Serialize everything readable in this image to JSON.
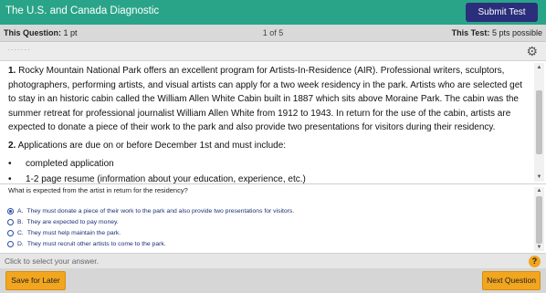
{
  "header": {
    "title": "The U.S. and Canada Diagnostic",
    "submit_label": "Submit Test",
    "accent": "#2aa488",
    "submit_color": "#2b2e7a"
  },
  "infobar": {
    "this_question_label": "This Question:",
    "this_question_value": "1 pt",
    "progress": "1 of 5",
    "this_test_label": "This Test:",
    "this_test_value": "5 pts possible"
  },
  "toolbar": {
    "settings_icon": "gear-icon"
  },
  "passage": {
    "item1_number": "1.",
    "item1_text": "Rocky Mountain National Park offers an excellent program for Artists-In-Residence (AIR). Professional writers, sculptors, photographers, performing artists, and visual artists can apply for a two week residency in the park. Artists who are selected get to stay in an historic cabin called the William Allen White Cabin built in 1887 which sits above Moraine Park. The cabin was the summer retreat for professional journalist William Allen White from 1912 to 1943. In return for the use of the cabin, artists are expected to donate a piece of their work to the park and also provide two presentations for visitors during their residency.",
    "item2_number": "2.",
    "item2_text": "Applications are due on or before December 1st and must include:",
    "bullets": [
      "completed application",
      "1-2 page resume (information about your education, experience, etc.)"
    ]
  },
  "question": {
    "prompt": "What is expected from the artist in return for the residency?",
    "choices": [
      {
        "letter": "A.",
        "text": "They must donate a piece of their work to the park and also provide two presentations for visitors.",
        "selected": true
      },
      {
        "letter": "B.",
        "text": "They are expected to pay money.",
        "selected": false
      },
      {
        "letter": "C.",
        "text": "They must help maintain the park.",
        "selected": false
      },
      {
        "letter": "D.",
        "text": "They must recruit other artists to come to the park.",
        "selected": false
      }
    ]
  },
  "status": {
    "message": "Click to select your answer.",
    "help_label": "?"
  },
  "footer": {
    "save_label": "Save for Later",
    "next_label": "Next Question",
    "button_color": "#f2a51f"
  }
}
